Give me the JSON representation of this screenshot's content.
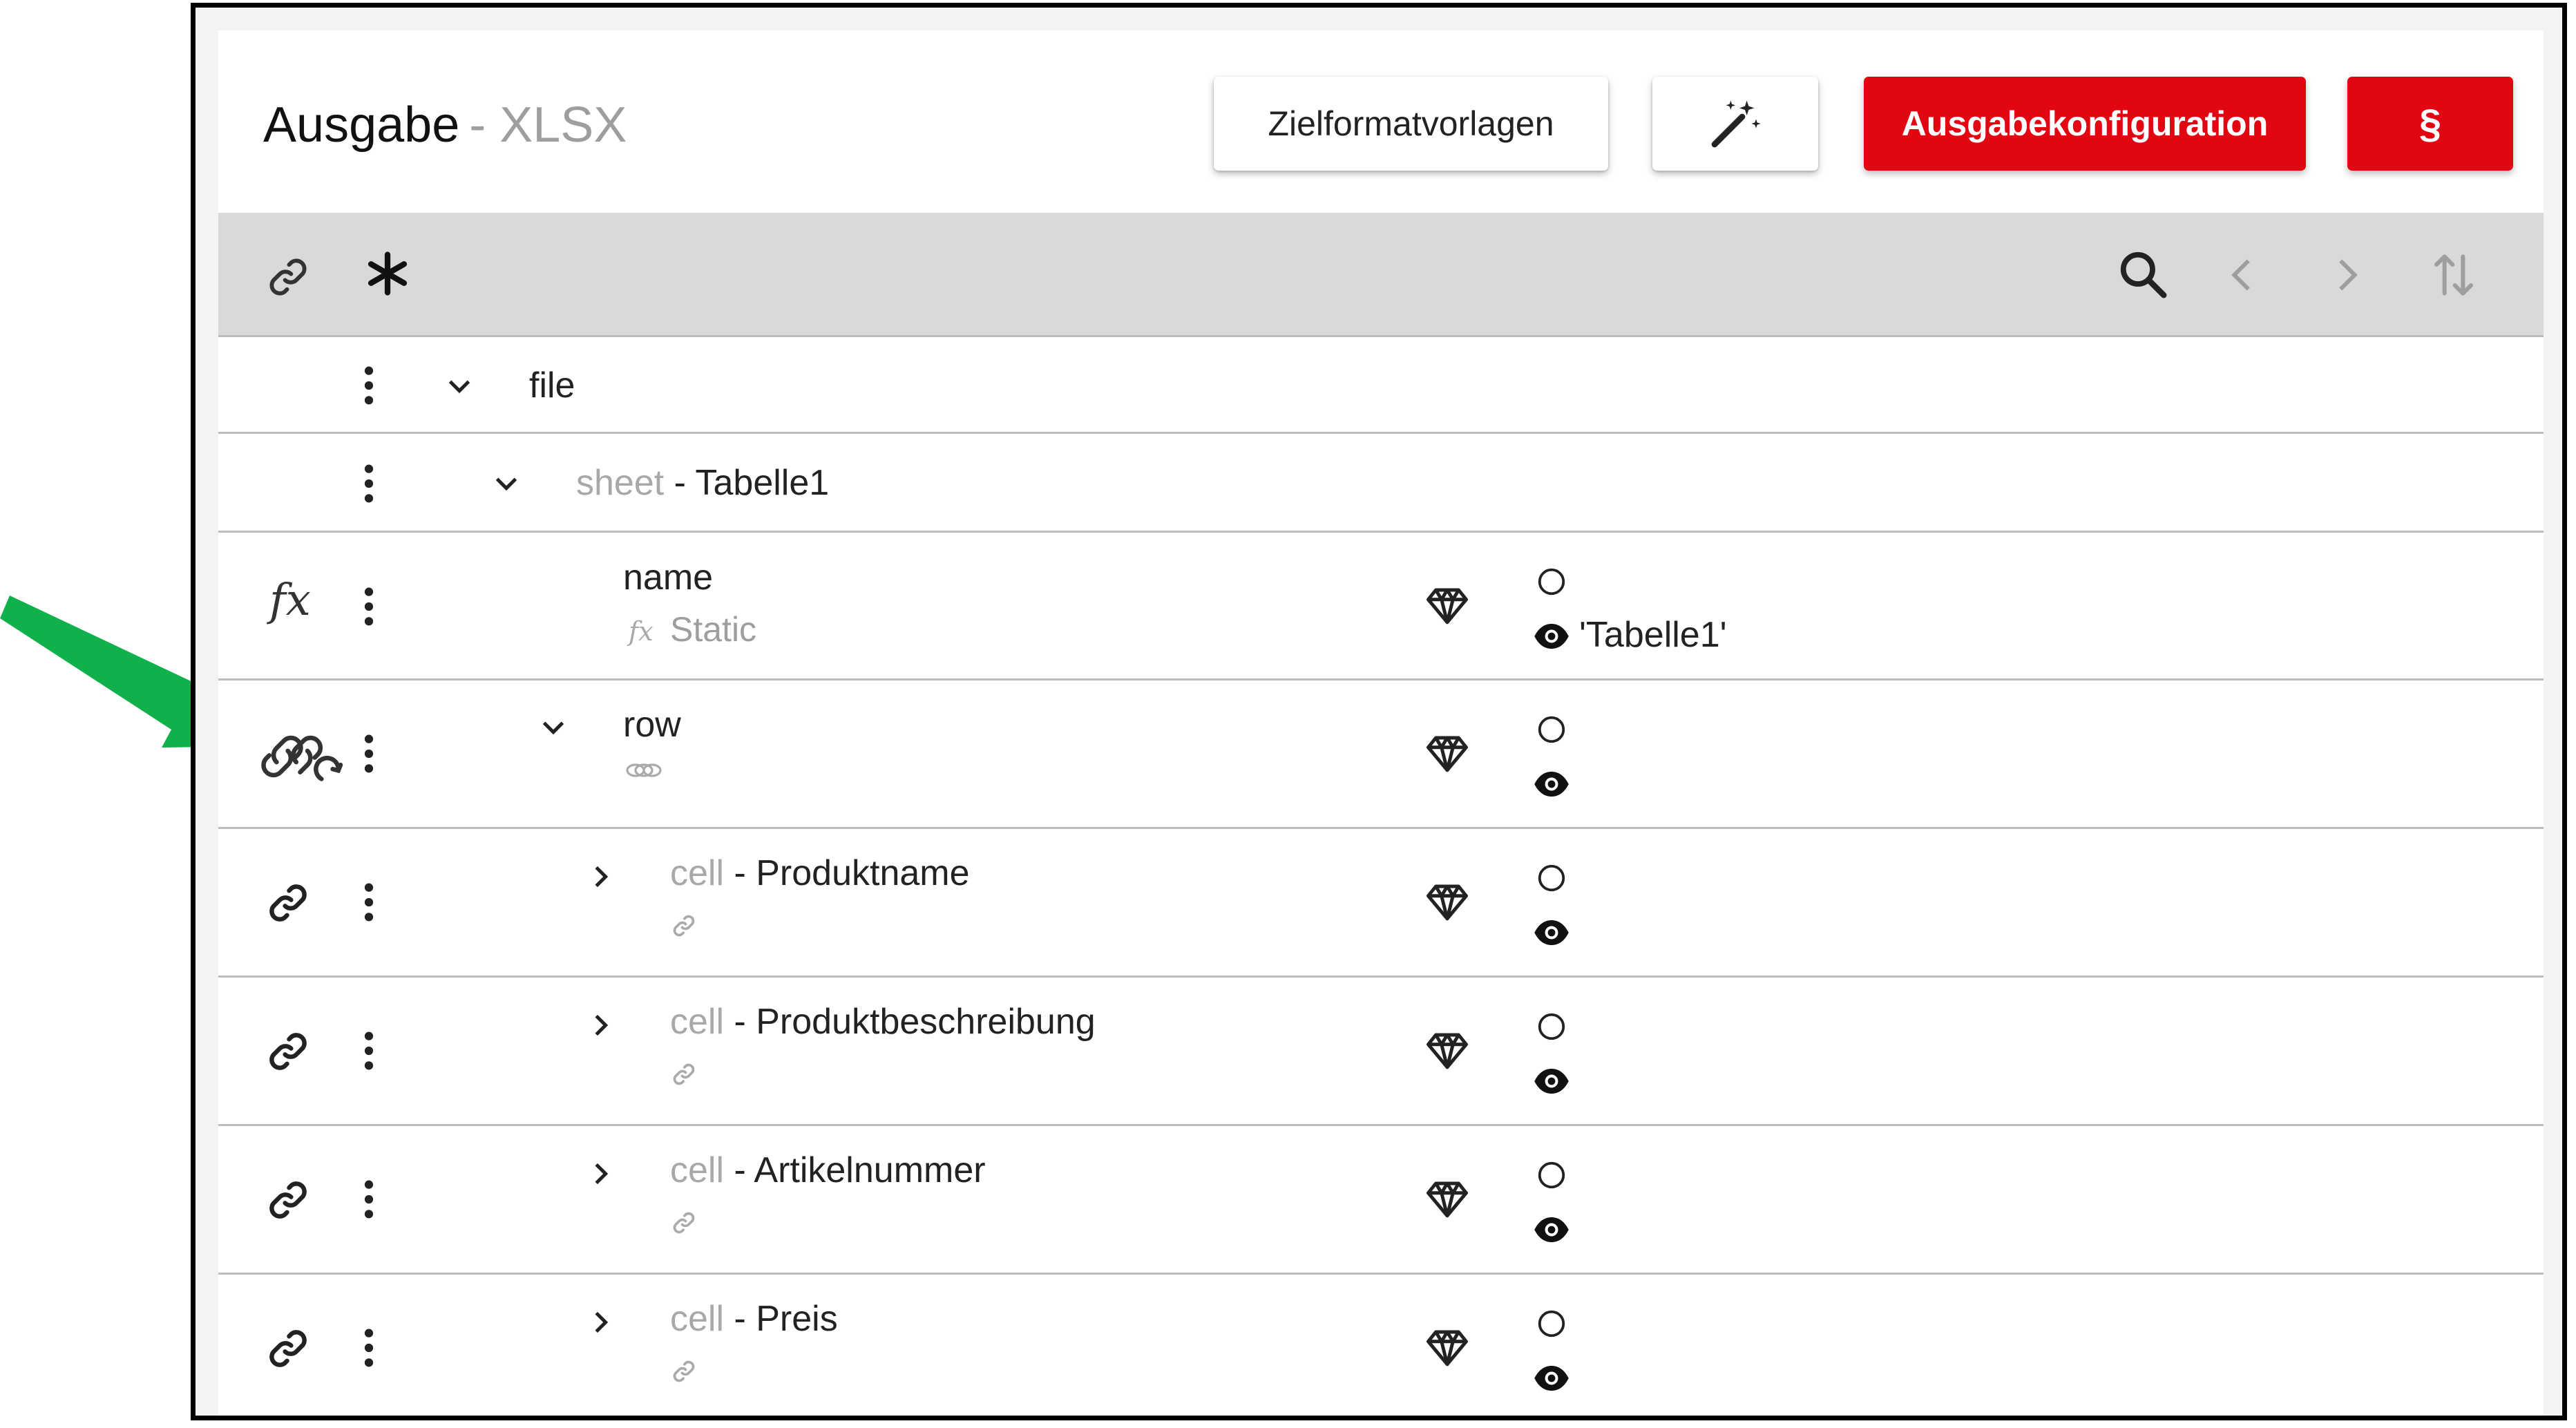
{
  "header": {
    "title": "Ausgabe",
    "format": "- XLSX",
    "buttons": {
      "templates": "Zielformatvorlagen",
      "wand_icon": "magic-wand-icon",
      "config": "Ausgabekonfiguration",
      "paragraph": "§"
    }
  },
  "toolbar": {
    "left_icons": [
      "link-icon",
      "asterisk-icon"
    ],
    "right_icons": [
      "search-icon",
      "chevron-left-icon",
      "chevron-right-icon",
      "sort-icon"
    ]
  },
  "tree": {
    "file": {
      "label": "file"
    },
    "sheet": {
      "type": "sheet",
      "name": "- Tabelle1"
    },
    "name": {
      "label": "name",
      "sub": "Static",
      "value": "'Tabelle1'"
    },
    "row": {
      "label": "row"
    },
    "cells": [
      {
        "type": "cell",
        "name": "- Produktname"
      },
      {
        "type": "cell",
        "name": "- Produktbeschreibung"
      },
      {
        "type": "cell",
        "name": "- Artikelnummer"
      },
      {
        "type": "cell",
        "name": "- Preis"
      }
    ]
  },
  "colors": {
    "accent_red": "#e20613",
    "toolbar_gray": "#d9d9d9",
    "annotation_arrow": "#10b04a",
    "muted_text": "#a8a8a8"
  }
}
